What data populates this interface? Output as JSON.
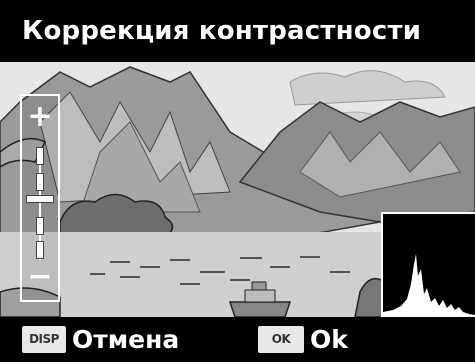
{
  "header": {
    "title": "Коррекция контрастности"
  },
  "slider": {
    "plus_symbol": "+",
    "minus_symbol": "−",
    "level_fraction": 0.5
  },
  "footer": {
    "cancel_key": "DISP",
    "cancel_label": "Отмена",
    "ok_key": "OK",
    "ok_label": "Ok"
  },
  "icons": [
    "mountain-landscape-image",
    "histogram-icon"
  ]
}
